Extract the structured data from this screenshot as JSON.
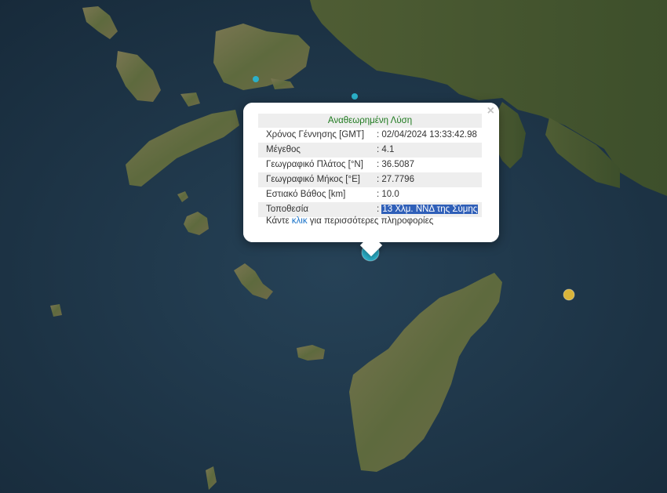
{
  "popup": {
    "title": "Αναθεωρημένη Λύση",
    "close_symbol": "×",
    "rows": [
      {
        "label": "Χρόνος Γέννησης [GMT]",
        "value": ": 02/04/2024 13:33:42.98"
      },
      {
        "label": "Μέγεθος",
        "value": ": 4.1"
      },
      {
        "label": "Γεωγραφικό Πλάτος [°N]",
        "value": ": 36.5087"
      },
      {
        "label": "Γεωγραφικό Μήκος [°E]",
        "value": ": 27.7796"
      },
      {
        "label": "Εστιακό Βάθος [km]",
        "value": ": 10.0"
      },
      {
        "label": "Τοποθεσία",
        "value_prefix": ": ",
        "value": "13 Χλμ. ΝΝΔ της Σύμης"
      }
    ],
    "more_prefix": "Κάντε ",
    "more_link": "κλικ",
    "more_suffix": " για περισσότερες πληροφορίες"
  },
  "colors": {
    "sea": "#1e3345",
    "land": "#6b6a4a",
    "marker_primary": "#2bb0c9",
    "marker_secondary": "#d9b43a",
    "title_green": "#1f7a1f",
    "link_blue": "#1a73c9",
    "highlight": "#2f5fb8"
  }
}
